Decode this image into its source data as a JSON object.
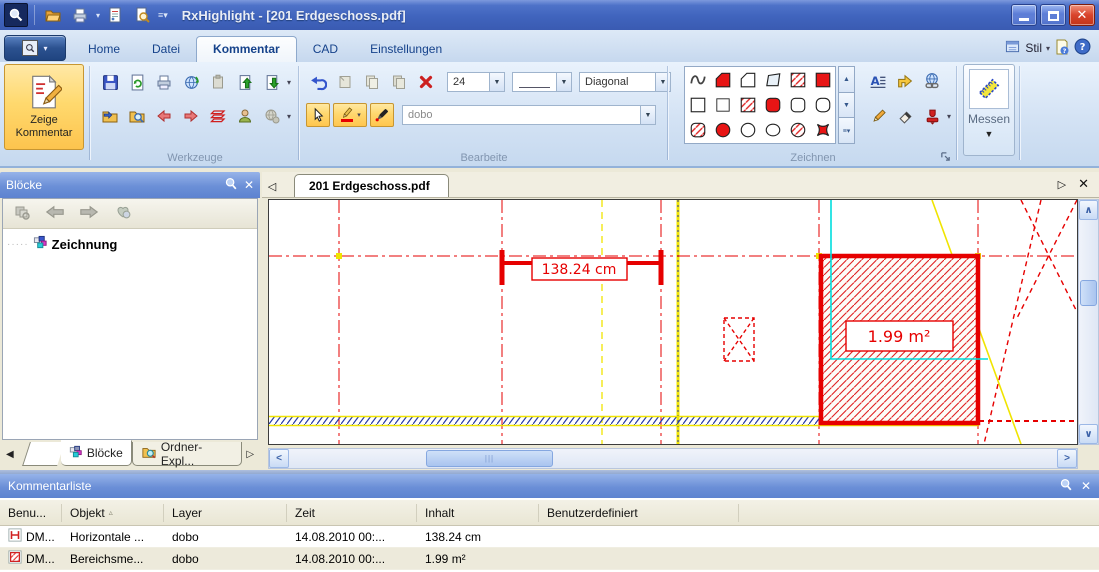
{
  "window": {
    "title": "RxHighlight - [201 Erdgeschoss.pdf]",
    "quick_access_icons": [
      "app-magnifier-icon",
      "open-folder-icon",
      "print-icon",
      "document-properties-icon",
      "print-preview-icon",
      "toolbar-customize-icon"
    ]
  },
  "ribbon_tabs": [
    "Home",
    "Datei",
    "Kommentar",
    "CAD",
    "Einstellungen"
  ],
  "active_tab": "Kommentar",
  "tabrow_right": {
    "stil_label": "Stil"
  },
  "ribbon": {
    "show_comment_line1": "Zeige",
    "show_comment_line2": "Kommentar",
    "groups": {
      "tools": "Werkzeuge",
      "edit": "Bearbeite",
      "draw": "Zeichnen"
    },
    "edit": {
      "size_value": "24",
      "line_style_value": "",
      "hatch_value": "Diagonal",
      "layer_value": "dobo"
    },
    "measure_label": "Messen"
  },
  "blocks_panel": {
    "title": "Blöcke",
    "tree": [
      "Zeichnung"
    ],
    "bottom_tabs": [
      "Blöcke",
      "Ordner-Expl..."
    ]
  },
  "document": {
    "tab_label": "201 Erdgeschoss.pdf"
  },
  "drawing": {
    "dimension_label": "138.24 cm",
    "area_label": "1.99 m²"
  },
  "comment_panel": {
    "title": "Kommentarliste",
    "columns": [
      "Benu...",
      "Objekt",
      "Layer",
      "Zeit",
      "Inhalt",
      "Benutzerdefiniert"
    ],
    "rows": [
      {
        "benutzer": "DM...",
        "objekt": "Horizontale ...",
        "layer": "dobo",
        "zeit": "14.08.2010 00:...",
        "inhalt": "138.24 cm",
        "benutzerdefiniert": ""
      },
      {
        "benutzer": "DM...",
        "objekt": "Bereichsme...",
        "layer": "dobo",
        "zeit": "14.08.2010 00:...",
        "inhalt": "1.99 m²",
        "benutzerdefiniert": ""
      }
    ]
  },
  "colors": {
    "annotation_red": "#e60000",
    "grid_yellow": "#f5ec00",
    "selection_cyan": "#00dede",
    "toggle_orange": "#ffc64e",
    "titlebar_blue": "#4a6fc6"
  }
}
